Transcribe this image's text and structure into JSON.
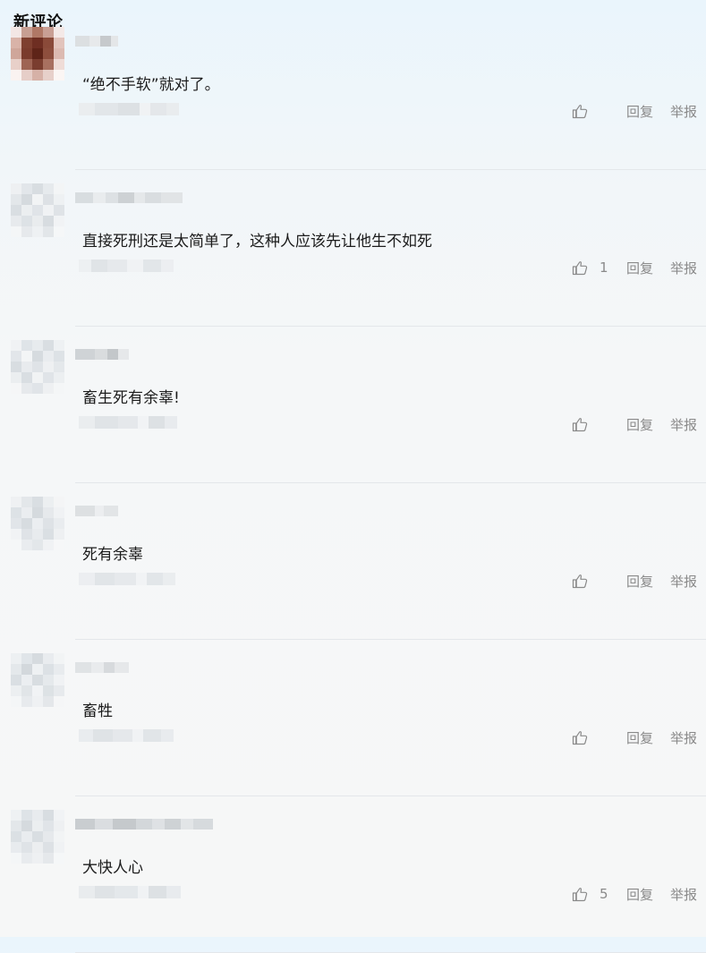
{
  "section": {
    "title": "新评论"
  },
  "labels": {
    "reply": "回复",
    "report": "举报"
  },
  "icons": {
    "like": "thumbs-up-icon",
    "avatar": "pixelated-avatar",
    "username": "pixelated-username",
    "timestamp": "pixelated-timestamp"
  },
  "colors": {
    "action_text": "#8a8a8a",
    "content_text": "#1c1c1c",
    "divider": "#e3e7ea"
  },
  "comments": [
    {
      "content": "“绝不手软”就对了。",
      "likes": ""
    },
    {
      "content": "直接死刑还是太简单了，这种人应该先让他生不如死",
      "likes": "1"
    },
    {
      "content": "畜生死有余辜!",
      "likes": ""
    },
    {
      "content": "死有余辜",
      "likes": ""
    },
    {
      "content": "畜牲",
      "likes": ""
    },
    {
      "content": "大快人心",
      "likes": "5"
    }
  ]
}
